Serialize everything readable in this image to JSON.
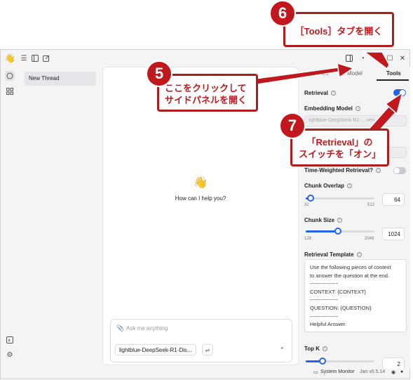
{
  "thread_list": {
    "items": [
      "New Thread"
    ]
  },
  "chat": {
    "greeting_emoji": "👋",
    "greeting": "How can I help you?",
    "input_placeholder": "Ask me anything",
    "model_name": "lightblue-DeepSeek-R1-Dis..."
  },
  "panel": {
    "tabs": [
      "Assistant",
      "Model",
      "Tools"
    ],
    "active_tab": "Tools",
    "retrieval_label": "Retrieval",
    "retrieval_on": true,
    "embedding_label": "Embedding Model",
    "embedding_value": "lightblue-DeepSeek-R1-...-ven",
    "time_weighted_label": "Time-Weighted Retrieval?",
    "time_weighted_on": false,
    "chunk_overlap": {
      "label": "Chunk Overlap",
      "min": "32",
      "max": "512",
      "value": "64",
      "fraction": 0.07
    },
    "chunk_size": {
      "label": "Chunk Size",
      "min": "128",
      "max": "2048",
      "value": "1024",
      "fraction": 0.47
    },
    "template_label": "Retrieval Template",
    "template_lines": [
      "Use the following pieces of context",
      "to answer the question at the end.",
      "----------------",
      "CONTEXT: {CONTEXT}",
      "----------------",
      "QUESTION: {QUESTION}",
      "----------------",
      "Helpful Answer:"
    ],
    "topk_label": "Top K",
    "topk_value": "2"
  },
  "status": {
    "system_monitor": "System Monitor",
    "version": "Jan v0.5.14"
  },
  "annotations": {
    "c5": {
      "number": "5",
      "lines": [
        "ここをクリックして",
        "サイドパネルを開く"
      ]
    },
    "c6": {
      "number": "6",
      "text": "［Tools］タブを開く"
    },
    "c7": {
      "number": "7",
      "lines": [
        "「Retrieval」の",
        "スイッチを「オン」"
      ]
    }
  },
  "colors": {
    "accent": "#2563eb",
    "callout_red": "#c0181c"
  }
}
